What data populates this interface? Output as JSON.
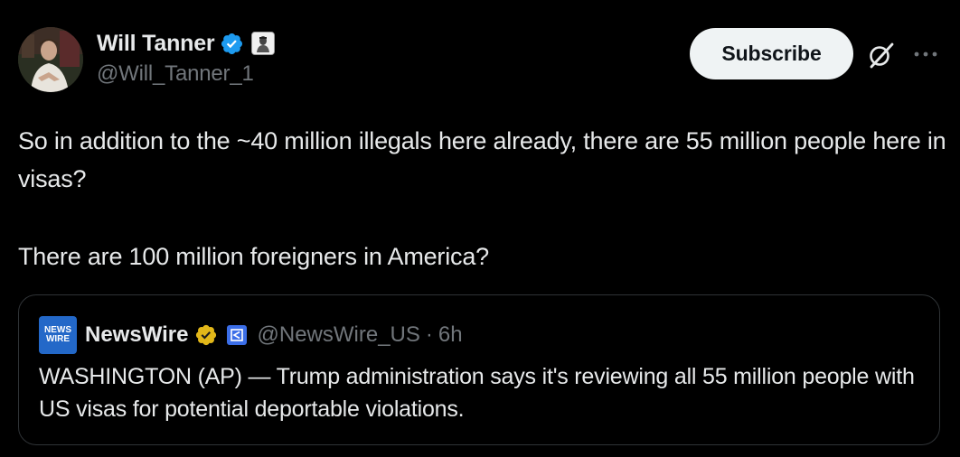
{
  "author": {
    "display_name": "Will Tanner",
    "handle": "@Will_Tanner_1",
    "verified": true,
    "avatar_icon": "profile-photo"
  },
  "actions": {
    "subscribe_label": "Subscribe",
    "grok_icon": "grok-icon",
    "more_icon": "more-icon"
  },
  "tweet": {
    "paragraphs": [
      "So in addition to the ~40 million illegals here already, there are 55 million people here in visas?",
      "There are 100 million foreigners in America?"
    ]
  },
  "quote": {
    "avatar_line1": "NEWS",
    "avatar_line2": "WIRE",
    "display_name": "NewsWire",
    "handle": "@NewsWire_US",
    "separator": "·",
    "time": "6h",
    "text": "WASHINGTON (AP) — Trump administration says it's reviewing all 55 million people with US visas for potential deportable violations."
  },
  "colors": {
    "background": "#000000",
    "text_primary": "#e7e9ea",
    "text_secondary": "#71767b",
    "verified_blue": "#1d9bf0",
    "verified_gold": "#e2b719",
    "border": "#2f3336",
    "button_bg": "#eff3f4"
  }
}
